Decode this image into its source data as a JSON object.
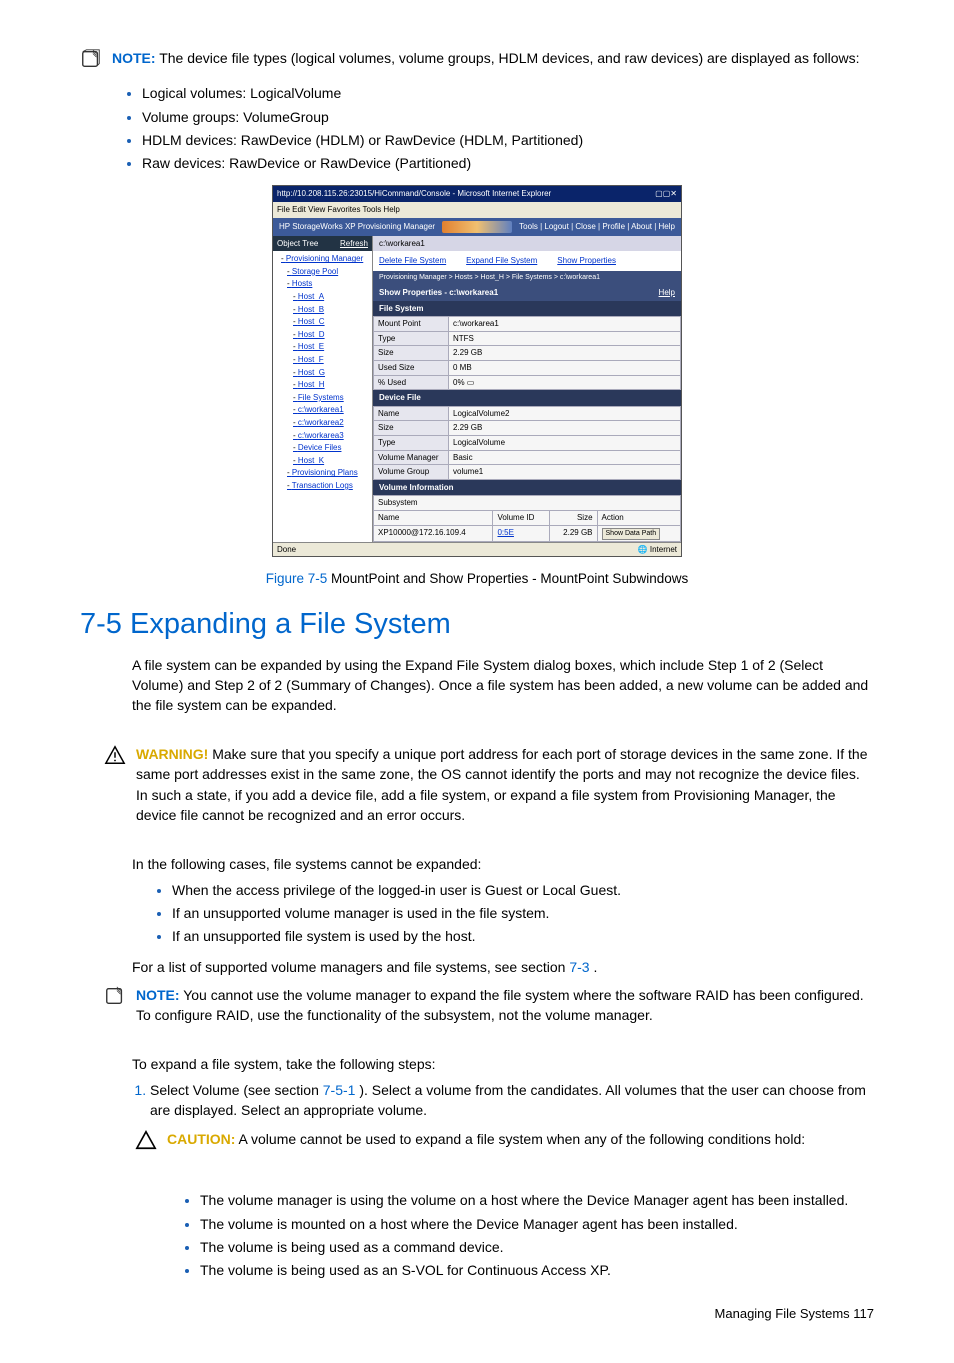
{
  "note1": {
    "label": "NOTE:",
    "text": " The device file types (logical volumes, volume groups, HDLM devices, and raw devices) are displayed as follows:",
    "bullets": [
      "Logical volumes: LogicalVolume",
      "Volume groups: VolumeGroup",
      "HDLM devices: RawDevice (HDLM) or RawDevice (HDLM, Partitioned)",
      "Raw devices: RawDevice or RawDevice (Partitioned)"
    ]
  },
  "screenshot": {
    "titlebar": "http://10.208.115.26:23015/HiCommand/Console - Microsoft Internet Explorer",
    "menubar": "File  Edit  View  Favorites  Tools  Help",
    "app_title": "HP StorageWorks XP Provisioning Manager",
    "app_links": "Tools | Logout | Close | Profile | About | Help",
    "tree_header": "Object Tree",
    "tree_refresh": "Refresh",
    "tree": [
      {
        "t": "Provisioning Manager",
        "c": "marker"
      },
      {
        "t": "Storage Pool",
        "c": "ind1 marker"
      },
      {
        "t": "Hosts",
        "c": "ind1 marker"
      },
      {
        "t": "Host_A",
        "c": "ind2 marker"
      },
      {
        "t": "Host_B",
        "c": "ind2 marker"
      },
      {
        "t": "Host_C",
        "c": "ind2 marker"
      },
      {
        "t": "Host_D",
        "c": "ind2 marker"
      },
      {
        "t": "Host_E",
        "c": "ind2 marker"
      },
      {
        "t": "Host_F",
        "c": "ind2 marker"
      },
      {
        "t": "Host_G",
        "c": "ind2 marker"
      },
      {
        "t": "Host_H",
        "c": "ind2 marker"
      },
      {
        "t": "File Systems",
        "c": "ind2 marker"
      },
      {
        "t": "c:\\workarea1",
        "c": "ind2 marker"
      },
      {
        "t": "c:\\workarea2",
        "c": "ind2 marker"
      },
      {
        "t": "c:\\workarea3",
        "c": "ind2 marker"
      },
      {
        "t": "Device Files",
        "c": "ind2 marker"
      },
      {
        "t": "Host_K",
        "c": "ind2 marker"
      },
      {
        "t": "Provisioning Plans",
        "c": "ind1 marker"
      },
      {
        "t": "Transaction Logs",
        "c": "ind1 marker"
      }
    ],
    "breadcrumb_top": "c:\\workarea1",
    "mainlinks": [
      "Delete File System",
      "Expand File System",
      "Show Properties"
    ],
    "breadcrumb_path": "Provisioning Manager > Hosts > Host_H > File Systems > c:\\workarea1",
    "panel_title": "Show Properties - c:\\workarea1",
    "panel_help": "Help",
    "sec_fs": "File System",
    "rows_fs": [
      [
        "Mount Point",
        "c:\\workarea1"
      ],
      [
        "Type",
        "NTFS"
      ],
      [
        "Size",
        "2.29 GB"
      ],
      [
        "Used Size",
        "0 MB"
      ],
      [
        "% Used",
        "0% ▭"
      ]
    ],
    "sec_df": "Device File",
    "rows_df": [
      [
        "Name",
        "LogicalVolume2"
      ],
      [
        "Size",
        "2.29 GB"
      ],
      [
        "Type",
        "LogicalVolume"
      ],
      [
        "Volume Manager",
        "Basic"
      ],
      [
        "Volume Group",
        "volume1"
      ]
    ],
    "sec_vi": "Volume Information",
    "vi_sub": "Subsystem",
    "vi_hdr": [
      "Name",
      "Volume ID",
      "Size",
      "Action"
    ],
    "vi_row": [
      "XP10000@172.16.109.4",
      "0:5E",
      "2.29 GB",
      "Show Data Path"
    ],
    "status_left": "Done",
    "status_right": "Internet"
  },
  "figure": {
    "num": "Figure 7-5",
    "caption": " MountPoint and Show Properties - MountPoint Subwindows"
  },
  "heading": "7-5 Expanding a File System",
  "p1": "A file system can be expanded by using the Expand File System dialog boxes, which include Step 1 of 2 (Select Volume) and Step 2 of 2 (Summary of Changes). Once a file system has been added, a new volume can be added and the file system can be expanded.",
  "warn1": {
    "label": "WARNING!",
    "text": " Make sure that you specify a unique port address for each port of storage devices in the same zone. If the same port addresses exist in the same zone, the OS cannot identify the ports and may not recognize the device files. In such a state, if you add a device file, add a file system, or expand a file system from Provisioning Manager, the device file cannot be recognized and an error occurs."
  },
  "p2": "In the following cases, file systems cannot be expanded:",
  "cases": [
    "When the access privilege of the logged-in user is Guest or Local Guest.",
    "If an unsupported volume manager is used in the file system.",
    "If an unsupported file system is used by the host."
  ],
  "p3a": "For a list of supported volume managers and file systems, see section ",
  "p3link": "7-3",
  "p3b": " .",
  "note2": {
    "label": "NOTE:",
    "text": " You cannot use the volume manager to expand the file system where the software RAID has been configured. To configure RAID, use the functionality of the subsystem, not the volume manager."
  },
  "p4": "To expand a file system, take the following steps:",
  "step1a": "Select Volume (see section ",
  "step1link": "7-5-1",
  "step1b": " ). Select a volume from the candidates. All volumes that the user can choose from are displayed. Select an appropriate volume.",
  "caution": {
    "label": "CAUTION:",
    "text": " A volume cannot be used to expand a file system when any of the following conditions hold:"
  },
  "caution_bullets": [
    "The volume manager is using the volume on a host where the Device Manager agent has been installed.",
    "The volume is mounted on a host where the Device Manager agent has been installed.",
    "The volume is being used as a command device.",
    "The volume is being used as an S-VOL for Continuous Access XP."
  ],
  "footer": "Managing File Systems  117"
}
